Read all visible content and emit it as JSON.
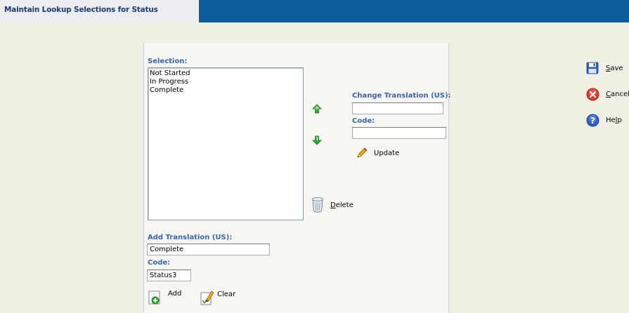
{
  "header": {
    "title": "Maintain Lookup Selections for Status"
  },
  "selection": {
    "label": "Selection:",
    "items": [
      "Not Started",
      "In Progress",
      "Complete"
    ]
  },
  "change": {
    "translation_label": "Change Translation (US):",
    "translation_value": "",
    "code_label": "Code:",
    "code_value": "",
    "update_label": "Update"
  },
  "delete_label": "Delete",
  "add": {
    "translation_label": "Add Translation (US):",
    "translation_value": "Complete",
    "code_label": "Code:",
    "code_value": "Status3",
    "add_label": "Add",
    "clear_label": "Clear"
  },
  "side_actions": {
    "save_label": "Save",
    "cancel_label": "Cancel",
    "help_label": "Help"
  },
  "colors": {
    "header_blue": "#0f5c9b",
    "label_blue": "#3a64b0",
    "arrow_green": "#2e9b2e"
  }
}
